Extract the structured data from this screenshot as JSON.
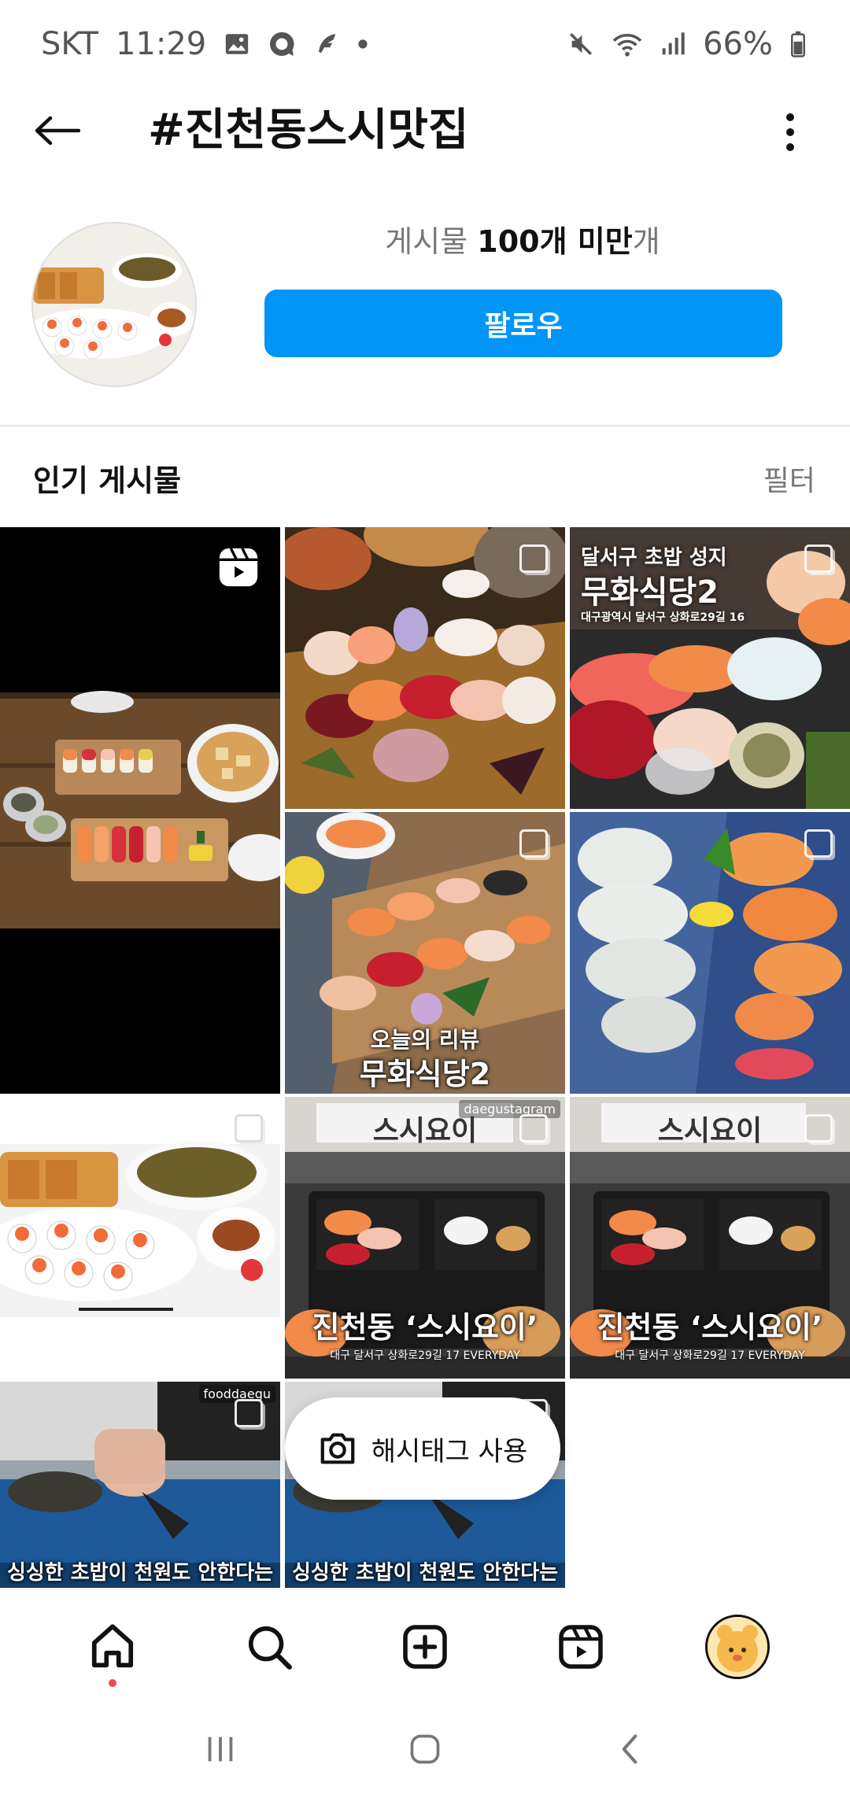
{
  "status_bar": {
    "carrier": "SKT",
    "time": "11:29",
    "battery": "66%",
    "icons": [
      "gallery-icon",
      "chat-icon",
      "feather-icon",
      "dot-icon",
      "mute-icon",
      "wifi-icon",
      "signal-icon",
      "battery-icon"
    ]
  },
  "header": {
    "title": "#진천동스시맛집",
    "back_icon": "arrow-left-icon",
    "more_icon": "more-vertical-icon"
  },
  "profile": {
    "posts_label": "게시물",
    "posts_count": "100개 미만",
    "posts_suffix": "개",
    "follow_label": "팔로우"
  },
  "section": {
    "title": "인기 게시물",
    "filter_label": "필터"
  },
  "posts": [
    {
      "kind": "reel",
      "icon": "reels-icon"
    },
    {
      "kind": "multi",
      "icon": "multiple-posts-icon"
    },
    {
      "kind": "multi",
      "icon": "multiple-posts-icon",
      "top_line": "달서구 초밥 성지",
      "title": "무화식당2",
      "sub": "대구광역시 달서구 상화로29길 16"
    },
    {
      "kind": "multi",
      "icon": "multiple-posts-icon",
      "line1": "오늘의 리뷰",
      "title": "무화식당2"
    },
    {
      "kind": "multi",
      "icon": "multiple-posts-icon"
    },
    {
      "kind": "multi",
      "icon": "multiple-posts-icon"
    },
    {
      "kind": "multi",
      "icon": "multiple-posts-icon",
      "watermark": "daegustagram",
      "sign": "스시요이",
      "title": "진천동 ‘스시요이’",
      "sub": "대구 달서구 상화로29길 17 EVERYDAY"
    },
    {
      "kind": "multi",
      "icon": "multiple-posts-icon",
      "sign": "스시요이",
      "title": "진천동 ‘스시요이’",
      "sub": "대구 달서구 상화로29길 17 EVERYDAY"
    },
    {
      "kind": "multi",
      "icon": "multiple-posts-icon",
      "watermark": "fooddaegu",
      "title": "싱싱한 초밥이 천원도 안한다는"
    },
    {
      "kind": "multi",
      "icon": "multiple-posts-icon",
      "title": "싱싱한 초밥이 천원도 안한다는"
    }
  ],
  "hashtag_button": {
    "label": "해시태그 사용",
    "icon": "camera-icon"
  },
  "bottom_nav": {
    "items": [
      "home-icon",
      "search-icon",
      "create-post-icon",
      "reels-icon",
      "profile-avatar"
    ]
  },
  "system_nav": {
    "items": [
      "recent-apps-icon",
      "home-button-icon",
      "back-chevron-icon"
    ]
  },
  "colors": {
    "accent": "#0095f6",
    "notification_dot": "#ed4956"
  }
}
